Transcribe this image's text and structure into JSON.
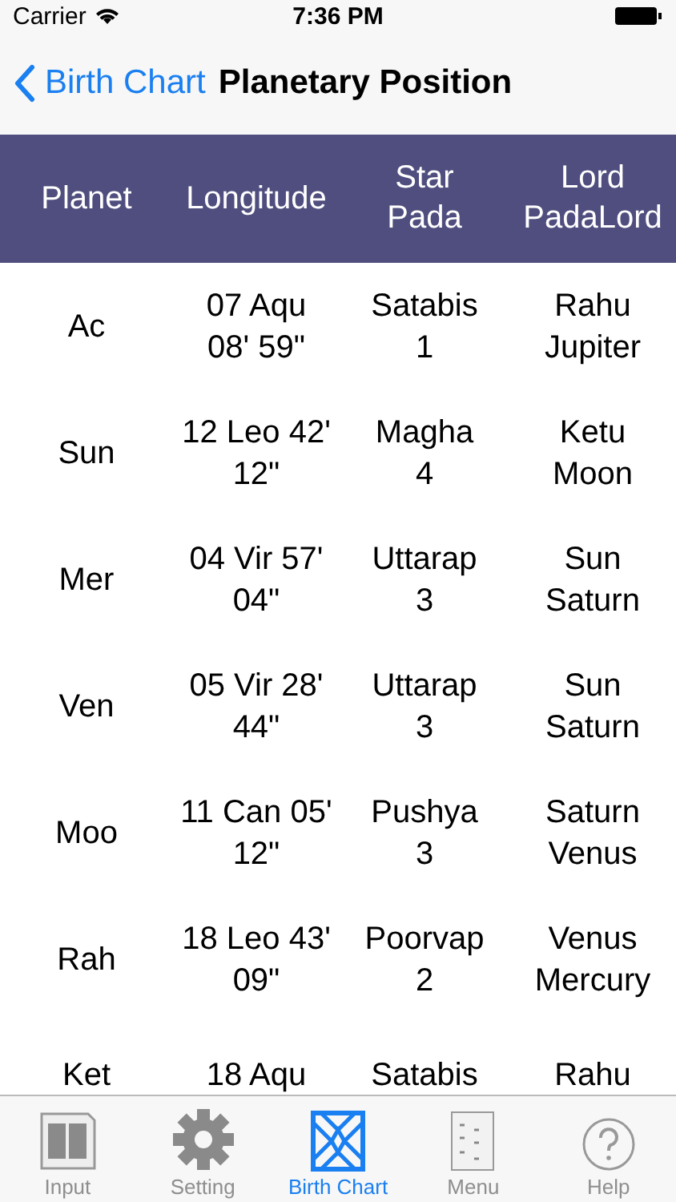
{
  "status_bar": {
    "carrier": "Carrier",
    "time": "7:36 PM"
  },
  "nav": {
    "back": "Birth Chart",
    "title": "Planetary Position"
  },
  "table": {
    "columns": [
      "Planet",
      "Longitude",
      "Star\nPada",
      "Lord\nPadaLord"
    ],
    "rows": [
      [
        "Ac",
        "07 Aqu\n08' 59\"",
        "Satabis\n1",
        "Rahu\nJupiter"
      ],
      [
        "Sun",
        "12 Leo 42'\n12\"",
        "Magha\n4",
        "Ketu\nMoon"
      ],
      [
        "Mer",
        "04 Vir 57'\n04\"",
        "Uttarap\n3",
        "Sun\nSaturn"
      ],
      [
        "Ven",
        "05 Vir 28'\n44\"",
        "Uttarap\n3",
        "Sun\nSaturn"
      ],
      [
        "Moo",
        "11 Can 05'\n12\"",
        "Pushya\n3",
        "Saturn\nVenus"
      ],
      [
        "Rah",
        "18 Leo 43'\n09\"",
        "Poorvap\n2",
        "Venus\nMercury"
      ],
      [
        "Ket",
        "18 Aqu",
        "Satabis",
        "Rahu"
      ]
    ]
  },
  "tab_bar": [
    {
      "label": "Input",
      "kind": "input",
      "selected": false
    },
    {
      "label": "Setting",
      "kind": "setting",
      "selected": false
    },
    {
      "label": "Birth Chart",
      "kind": "chart",
      "selected": true
    },
    {
      "label": "Menu",
      "kind": "menu",
      "selected": false
    },
    {
      "label": "Help",
      "kind": "help",
      "selected": false
    }
  ]
}
